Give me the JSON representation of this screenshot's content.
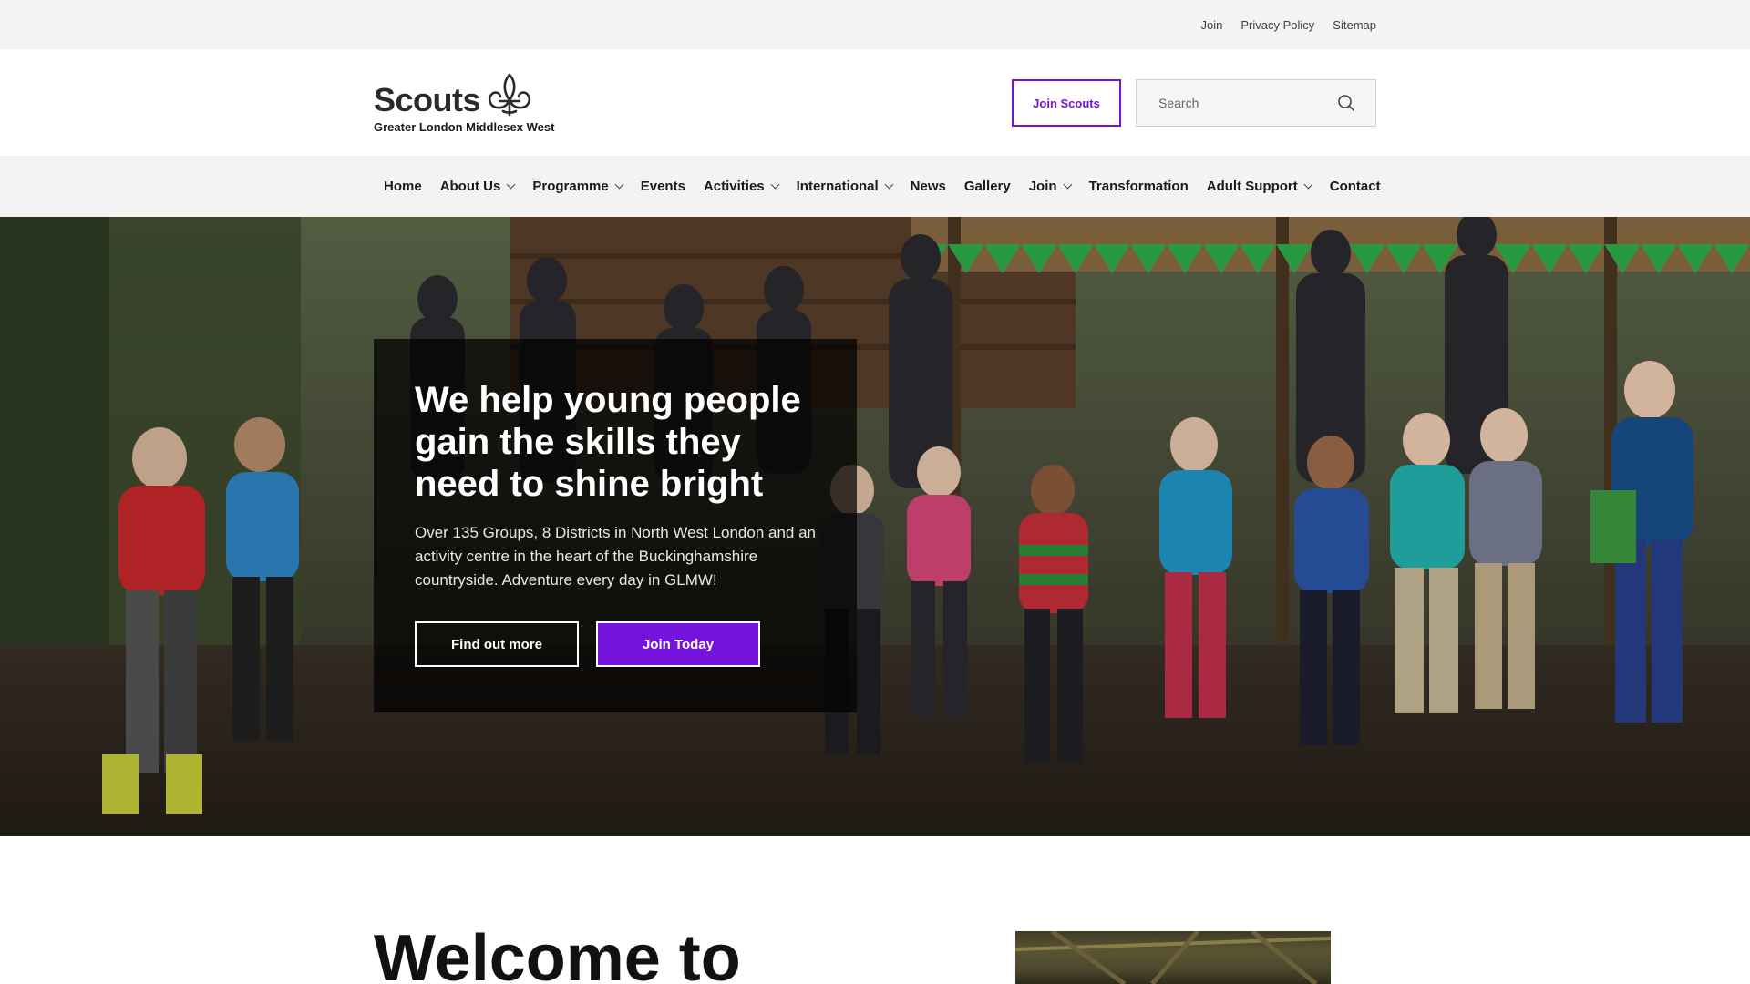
{
  "utility": {
    "links": [
      "Join",
      "Privacy Policy",
      "Sitemap"
    ]
  },
  "header": {
    "logo_word": "Scouts",
    "logo_sub": "Greater London Middlesex West",
    "join_button": "Join Scouts",
    "search_placeholder": "Search"
  },
  "nav": {
    "items": [
      {
        "label": "Home",
        "has_dropdown": false
      },
      {
        "label": "About Us",
        "has_dropdown": true
      },
      {
        "label": "Programme",
        "has_dropdown": true
      },
      {
        "label": "Events",
        "has_dropdown": false
      },
      {
        "label": "Activities",
        "has_dropdown": true
      },
      {
        "label": "International",
        "has_dropdown": true
      },
      {
        "label": "News",
        "has_dropdown": false
      },
      {
        "label": "Gallery",
        "has_dropdown": false
      },
      {
        "label": "Join",
        "has_dropdown": true
      },
      {
        "label": "Transformation",
        "has_dropdown": false
      },
      {
        "label": "Adult Support",
        "has_dropdown": true
      },
      {
        "label": "Contact",
        "has_dropdown": false
      }
    ]
  },
  "hero": {
    "title": "We help young people gain the skills they need to shine bright",
    "text": "Over 135 Groups, 8 Districts in North West London and an activity centre in the heart of the Buckinghamshire countryside. Adventure every day in GLMW!",
    "find_out_more": "Find out more",
    "join_today": "Join Today"
  },
  "welcome": {
    "title": "Welcome to"
  },
  "colors": {
    "brand_purple": "#7413dc",
    "utility_bg": "#f3f3f3"
  }
}
